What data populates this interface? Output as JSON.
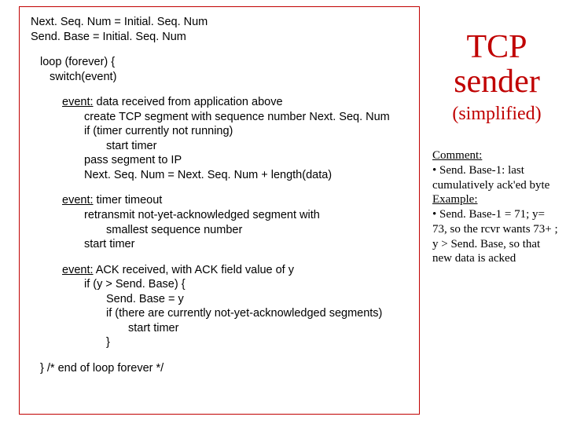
{
  "code": {
    "line1": "Next. Seq. Num = Initial. Seq. Num",
    "line2": "Send. Base = Initial. Seq. Num",
    "loop1": "loop (forever) {",
    "loop2": "switch(event)",
    "ev1_kw": "event:",
    "ev1_txt": " data received from application above",
    "ev1_a": "create TCP segment with sequence number Next. Seq. Num",
    "ev1_b": "if (timer currently not running)",
    "ev1_c": "start timer",
    "ev1_d": "pass segment to IP",
    "ev1_e": "Next. Seq. Num = Next. Seq. Num + length(data)",
    "ev2_kw": "event:",
    "ev2_txt": " timer timeout",
    "ev2_a": "retransmit not-yet-acknowledged segment with",
    "ev2_b": "smallest sequence number",
    "ev2_c": "start timer",
    "ev3_kw": "event:",
    "ev3_txt": " ACK received, with ACK field value of y",
    "ev3_a": "if (y > Send. Base) {",
    "ev3_b": "Send. Base = y",
    "ev3_c": "if (there are currently not-yet-acknowledged segments)",
    "ev3_d": "start timer",
    "ev3_e": "}",
    "end": "}  /* end of loop forever */"
  },
  "right": {
    "title": "TCP sender",
    "subtitle": "(simplified)",
    "c_head": "Comment:",
    "c1": " • Send. Base-1: last cumulatively ack'ed byte",
    "ex_head": "Example:",
    "ex1": " • Send. Base-1 = 71; y= 73, so the rcvr wants 73+ ;",
    "ex2": "y > Send. Base, so that new data is acked"
  }
}
